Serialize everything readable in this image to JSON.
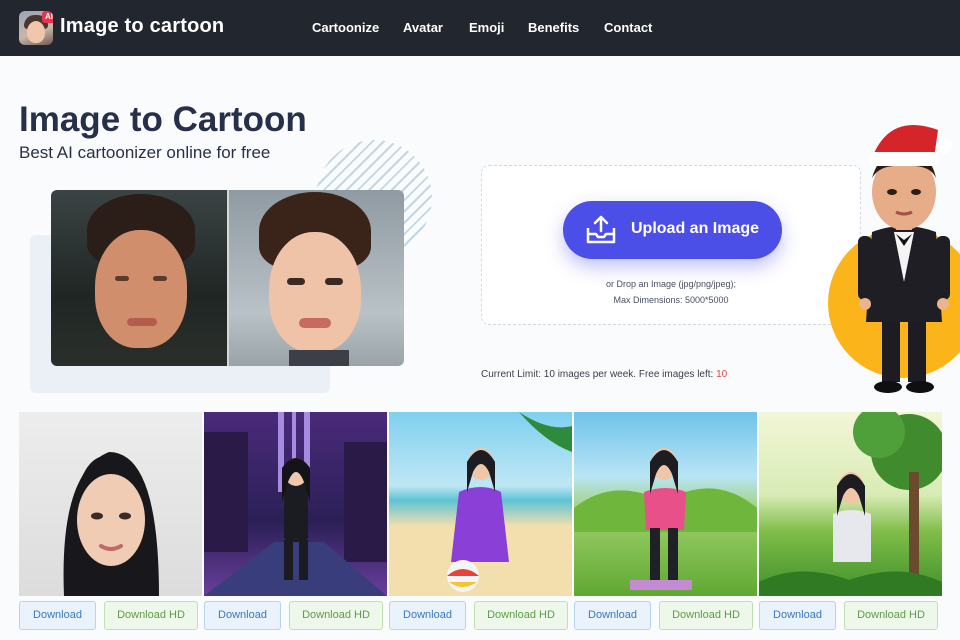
{
  "nav": {
    "brand": "Image to cartoon",
    "logo_badge": "AI",
    "links": [
      "Cartoonize",
      "Avatar",
      "Emoji",
      "Benefits",
      "Contact"
    ]
  },
  "hero": {
    "title": "Image to Cartoon",
    "subtitle": "Best AI cartoonizer online for free"
  },
  "upload": {
    "button_label": "Upload an Image",
    "icon": "upload-tray-icon",
    "drop_line1": "or Drop an Image (jpg/png/jpeg);",
    "drop_line2": "Max Dimensions: 5000*5000",
    "limit_text": "Current Limit: 10 images per week. Free images left:",
    "limit_count": "10"
  },
  "gallery": {
    "download_label": "Download",
    "download_hd_label": "Download HD",
    "count": 5
  },
  "colors": {
    "nav_bg": "#22262e",
    "accent": "#4b4fe8",
    "limit_count": "#e0453f",
    "orange": "#fbb419"
  }
}
